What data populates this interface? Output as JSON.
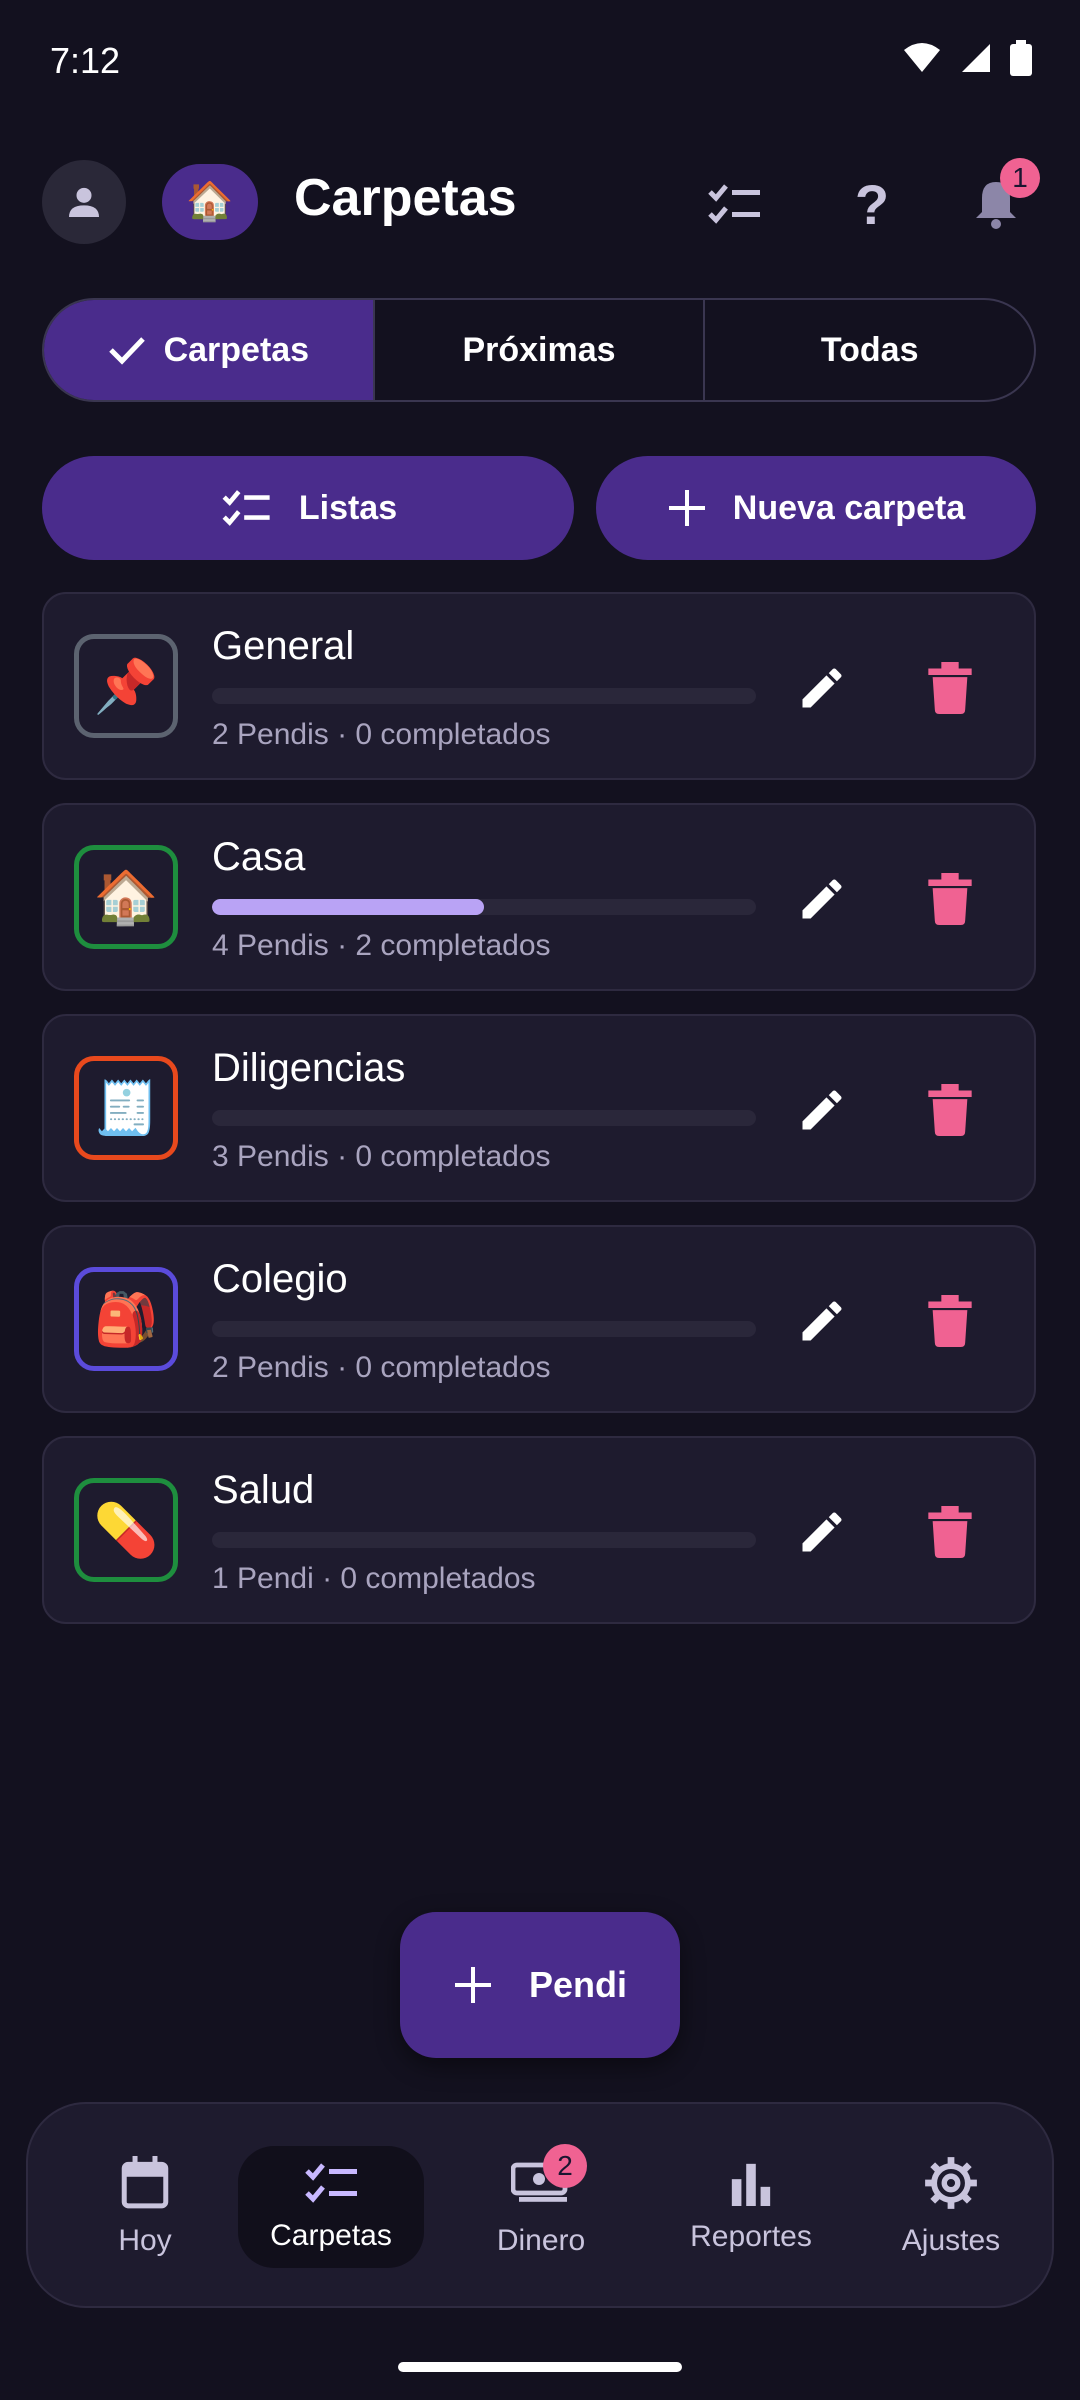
{
  "status": {
    "time": "7:12"
  },
  "header": {
    "title": "Carpetas",
    "home_emoji": "🏠",
    "notifications_count": "1"
  },
  "segments": [
    {
      "label": "Carpetas",
      "active": true
    },
    {
      "label": "Próximas",
      "active": false
    },
    {
      "label": "Todas",
      "active": false
    }
  ],
  "actions": {
    "lists_label": "Listas",
    "new_folder_label": "Nueva carpeta"
  },
  "folders": [
    {
      "name": "General",
      "emoji": "📌",
      "border": "#5c6370",
      "progress": 0.0,
      "subtitle": "2 Pendis · 0 completados"
    },
    {
      "name": "Casa",
      "emoji": "🏠",
      "border": "#1e8e3e",
      "progress": 0.5,
      "subtitle": "4 Pendis · 2 completados"
    },
    {
      "name": "Diligencias",
      "emoji": "🧾",
      "border": "#e8491d",
      "progress": 0.0,
      "subtitle": "3 Pendis · 0 completados"
    },
    {
      "name": "Colegio",
      "emoji": "🎒",
      "border": "#5b4bdb",
      "progress": 0.0,
      "subtitle": "2 Pendis · 0 completados"
    },
    {
      "name": "Salud",
      "emoji": "💊",
      "border": "#1e8e3e",
      "progress": 0.0,
      "subtitle": "1 Pendi · 0 completados"
    }
  ],
  "fab": {
    "label": "Pendi"
  },
  "nav": [
    {
      "label": "Hoy",
      "icon": "calendar-icon",
      "active": false
    },
    {
      "label": "Carpetas",
      "icon": "checklist-icon",
      "active": true
    },
    {
      "label": "Dinero",
      "icon": "money-icon",
      "active": false,
      "badge": "2"
    },
    {
      "label": "Reportes",
      "icon": "bar-chart-icon",
      "active": false
    },
    {
      "label": "Ajustes",
      "icon": "gear-icon",
      "active": false
    }
  ],
  "colors": {
    "background": "#13111f",
    "accent": "#4a2c8c",
    "card": "#1e1b2e",
    "delete": "#f06292",
    "progress": "#b9a3f5"
  }
}
